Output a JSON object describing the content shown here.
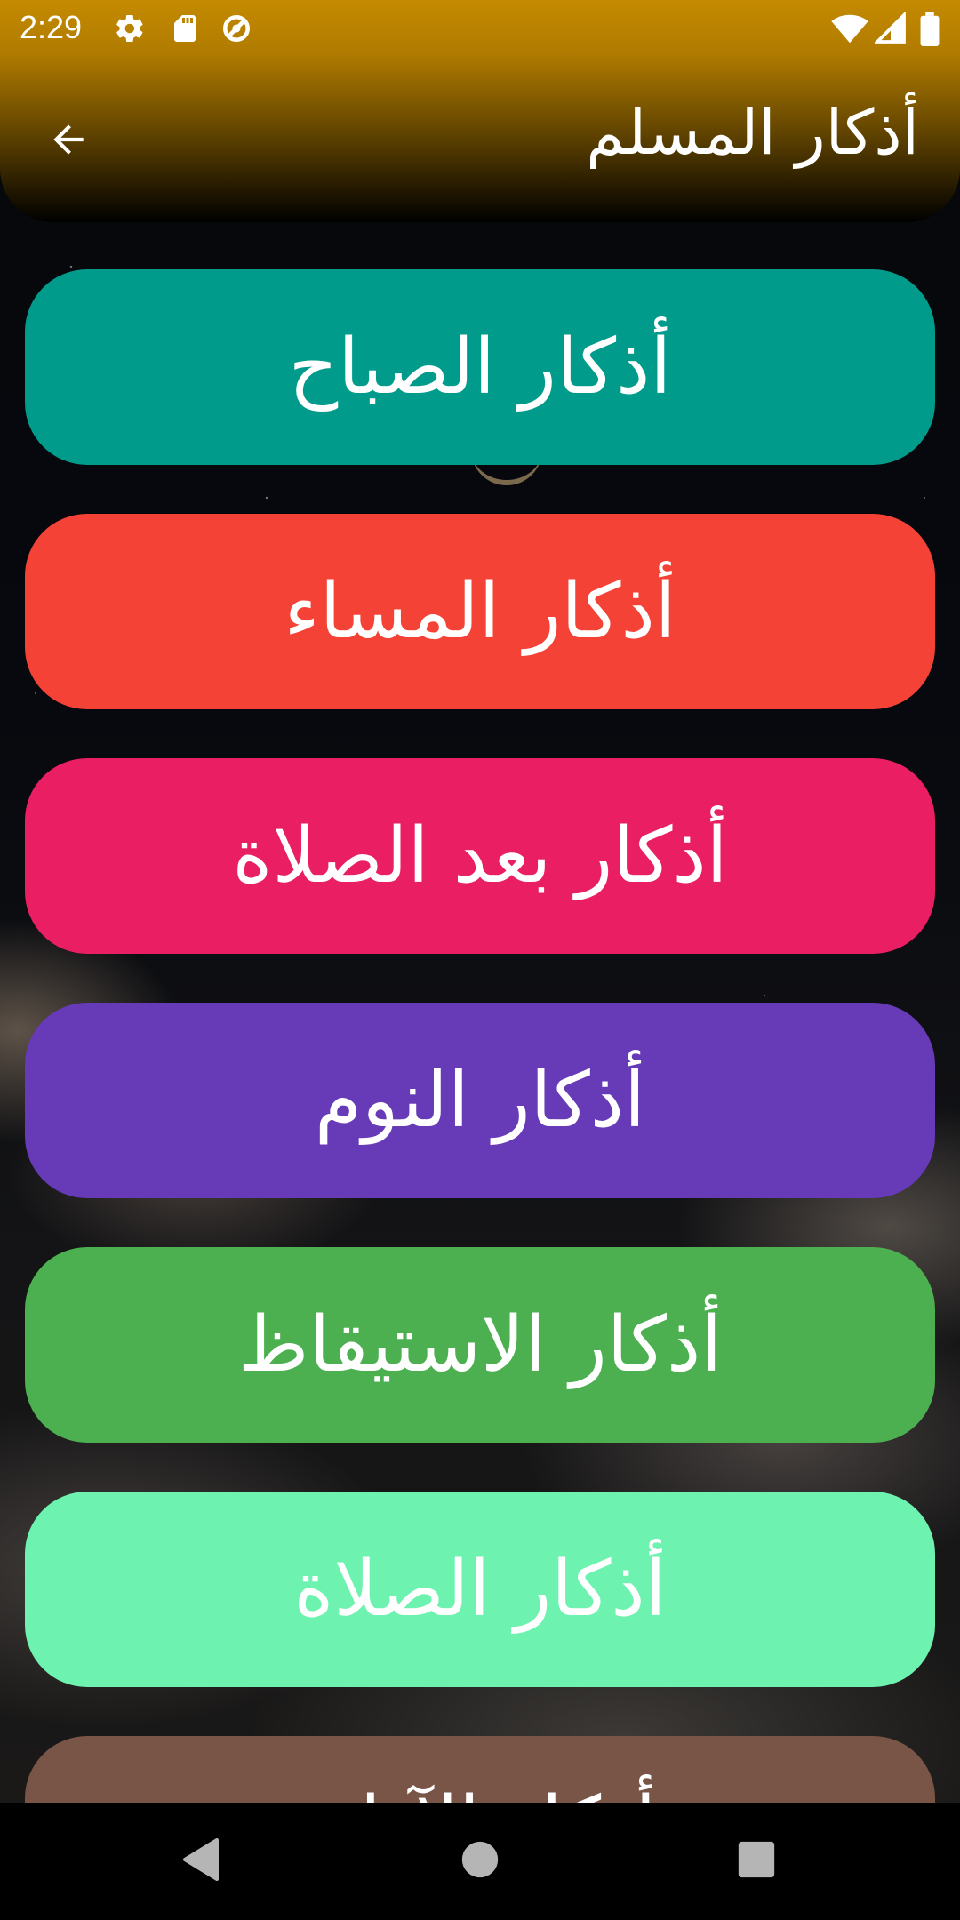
{
  "status_bar": {
    "time": "2:29",
    "icons": [
      "gear-icon",
      "sd-card-icon",
      "no-sync-icon",
      "wifi-icon",
      "signal-icon",
      "battery-icon"
    ]
  },
  "app_bar": {
    "title": "أذكار المسلم",
    "back_icon": "arrow-back-icon"
  },
  "categories": [
    {
      "label": "أذكار الصباح",
      "color": "#009B8A"
    },
    {
      "label": "أذكار المساء",
      "color": "#F44336"
    },
    {
      "label": "أذكار بعد الصلاة",
      "color": "#E91E63"
    },
    {
      "label": "أذكار النوم",
      "color": "#673AB7"
    },
    {
      "label": "أذكار الاستيقاظ",
      "color": "#4CAF50"
    },
    {
      "label": "أذكار الصلاة",
      "color": "#6EF2B0"
    },
    {
      "label": "أذكار الآذان",
      "color": "#795548"
    }
  ],
  "navigation_bar": {
    "buttons": [
      "back-triangle-icon",
      "home-circle-icon",
      "recents-square-icon"
    ]
  },
  "colors": {
    "app_bar_top": "#C48A00",
    "background": "#05070B"
  }
}
